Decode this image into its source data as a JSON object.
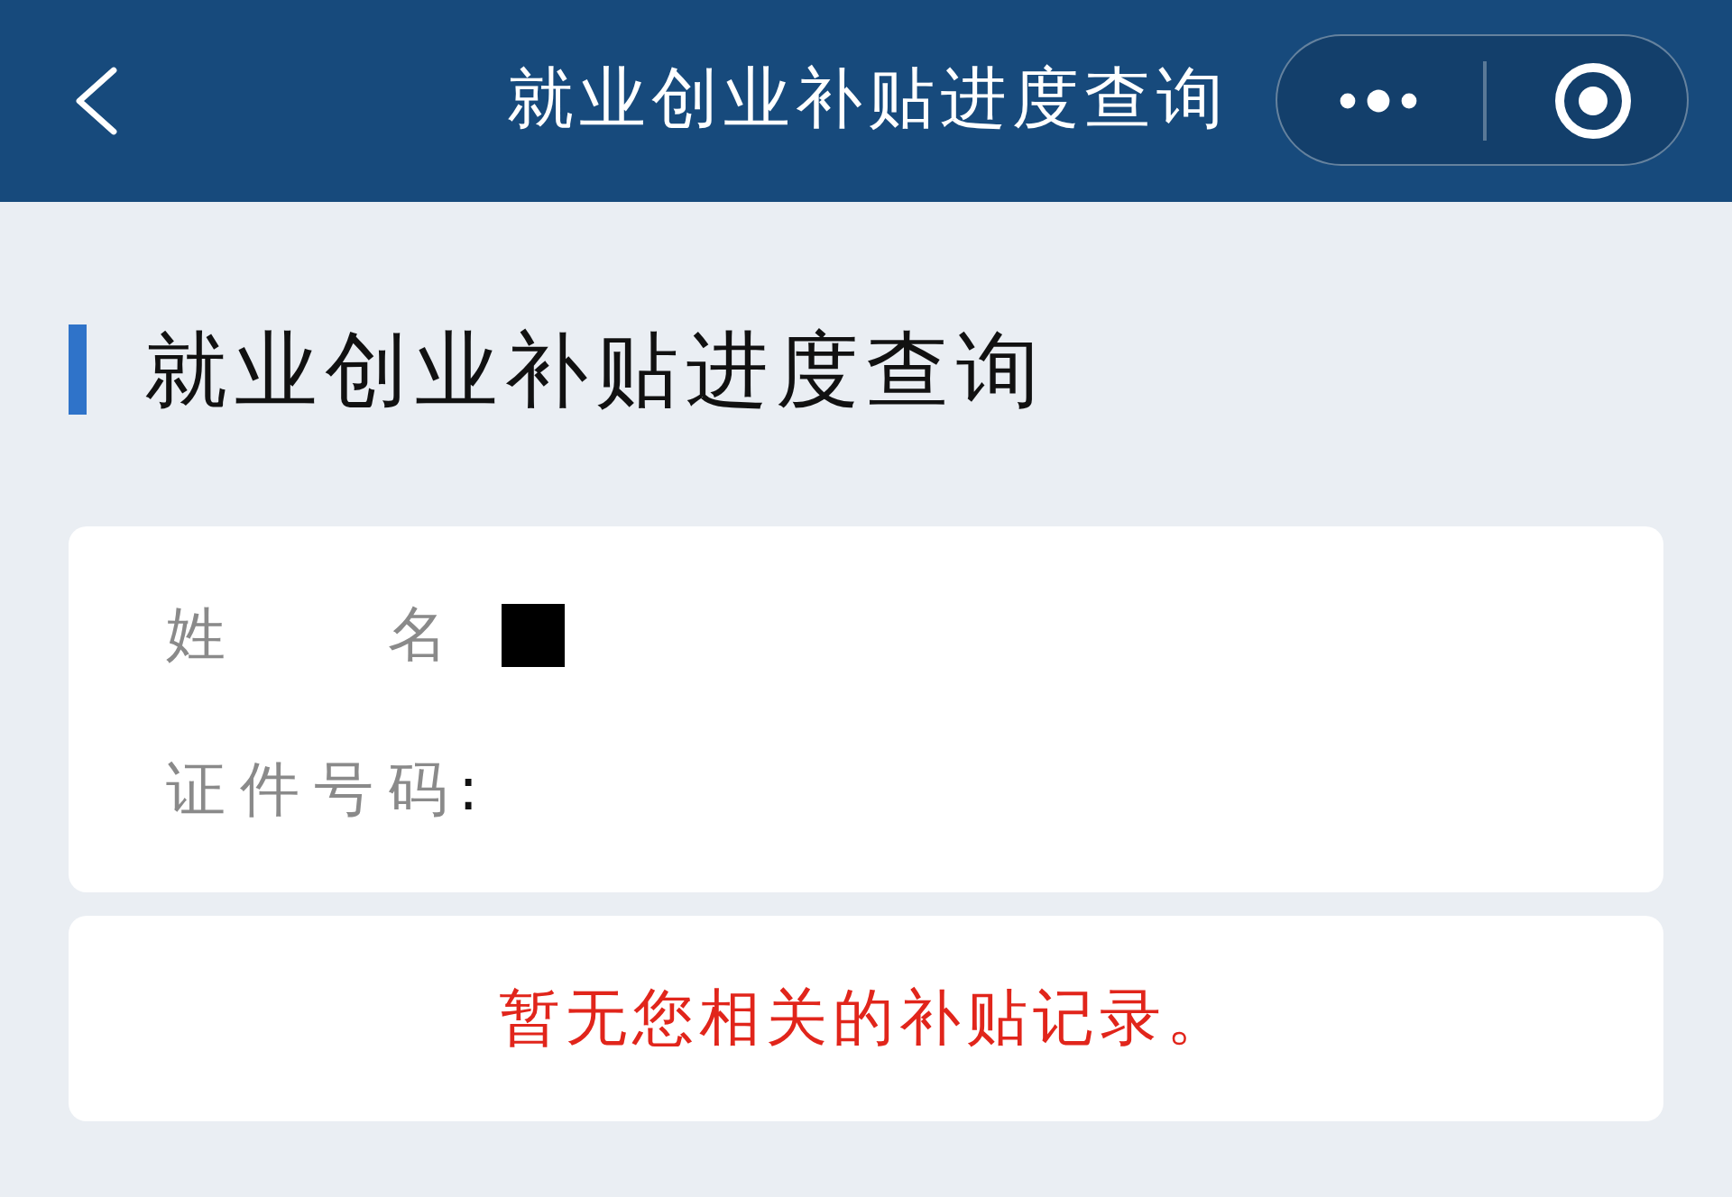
{
  "nav_bar": {
    "title": "就业创业补贴进度查询"
  },
  "section": {
    "heading": "就业创业补贴进度查询"
  },
  "info_card": {
    "fields": [
      {
        "kind": "redacted",
        "label": "姓　　名"
      },
      {
        "kind": "text",
        "label": "证件号码",
        "value": ":"
      }
    ]
  },
  "notice": {
    "message": "暂无您相关的补贴记录。"
  }
}
